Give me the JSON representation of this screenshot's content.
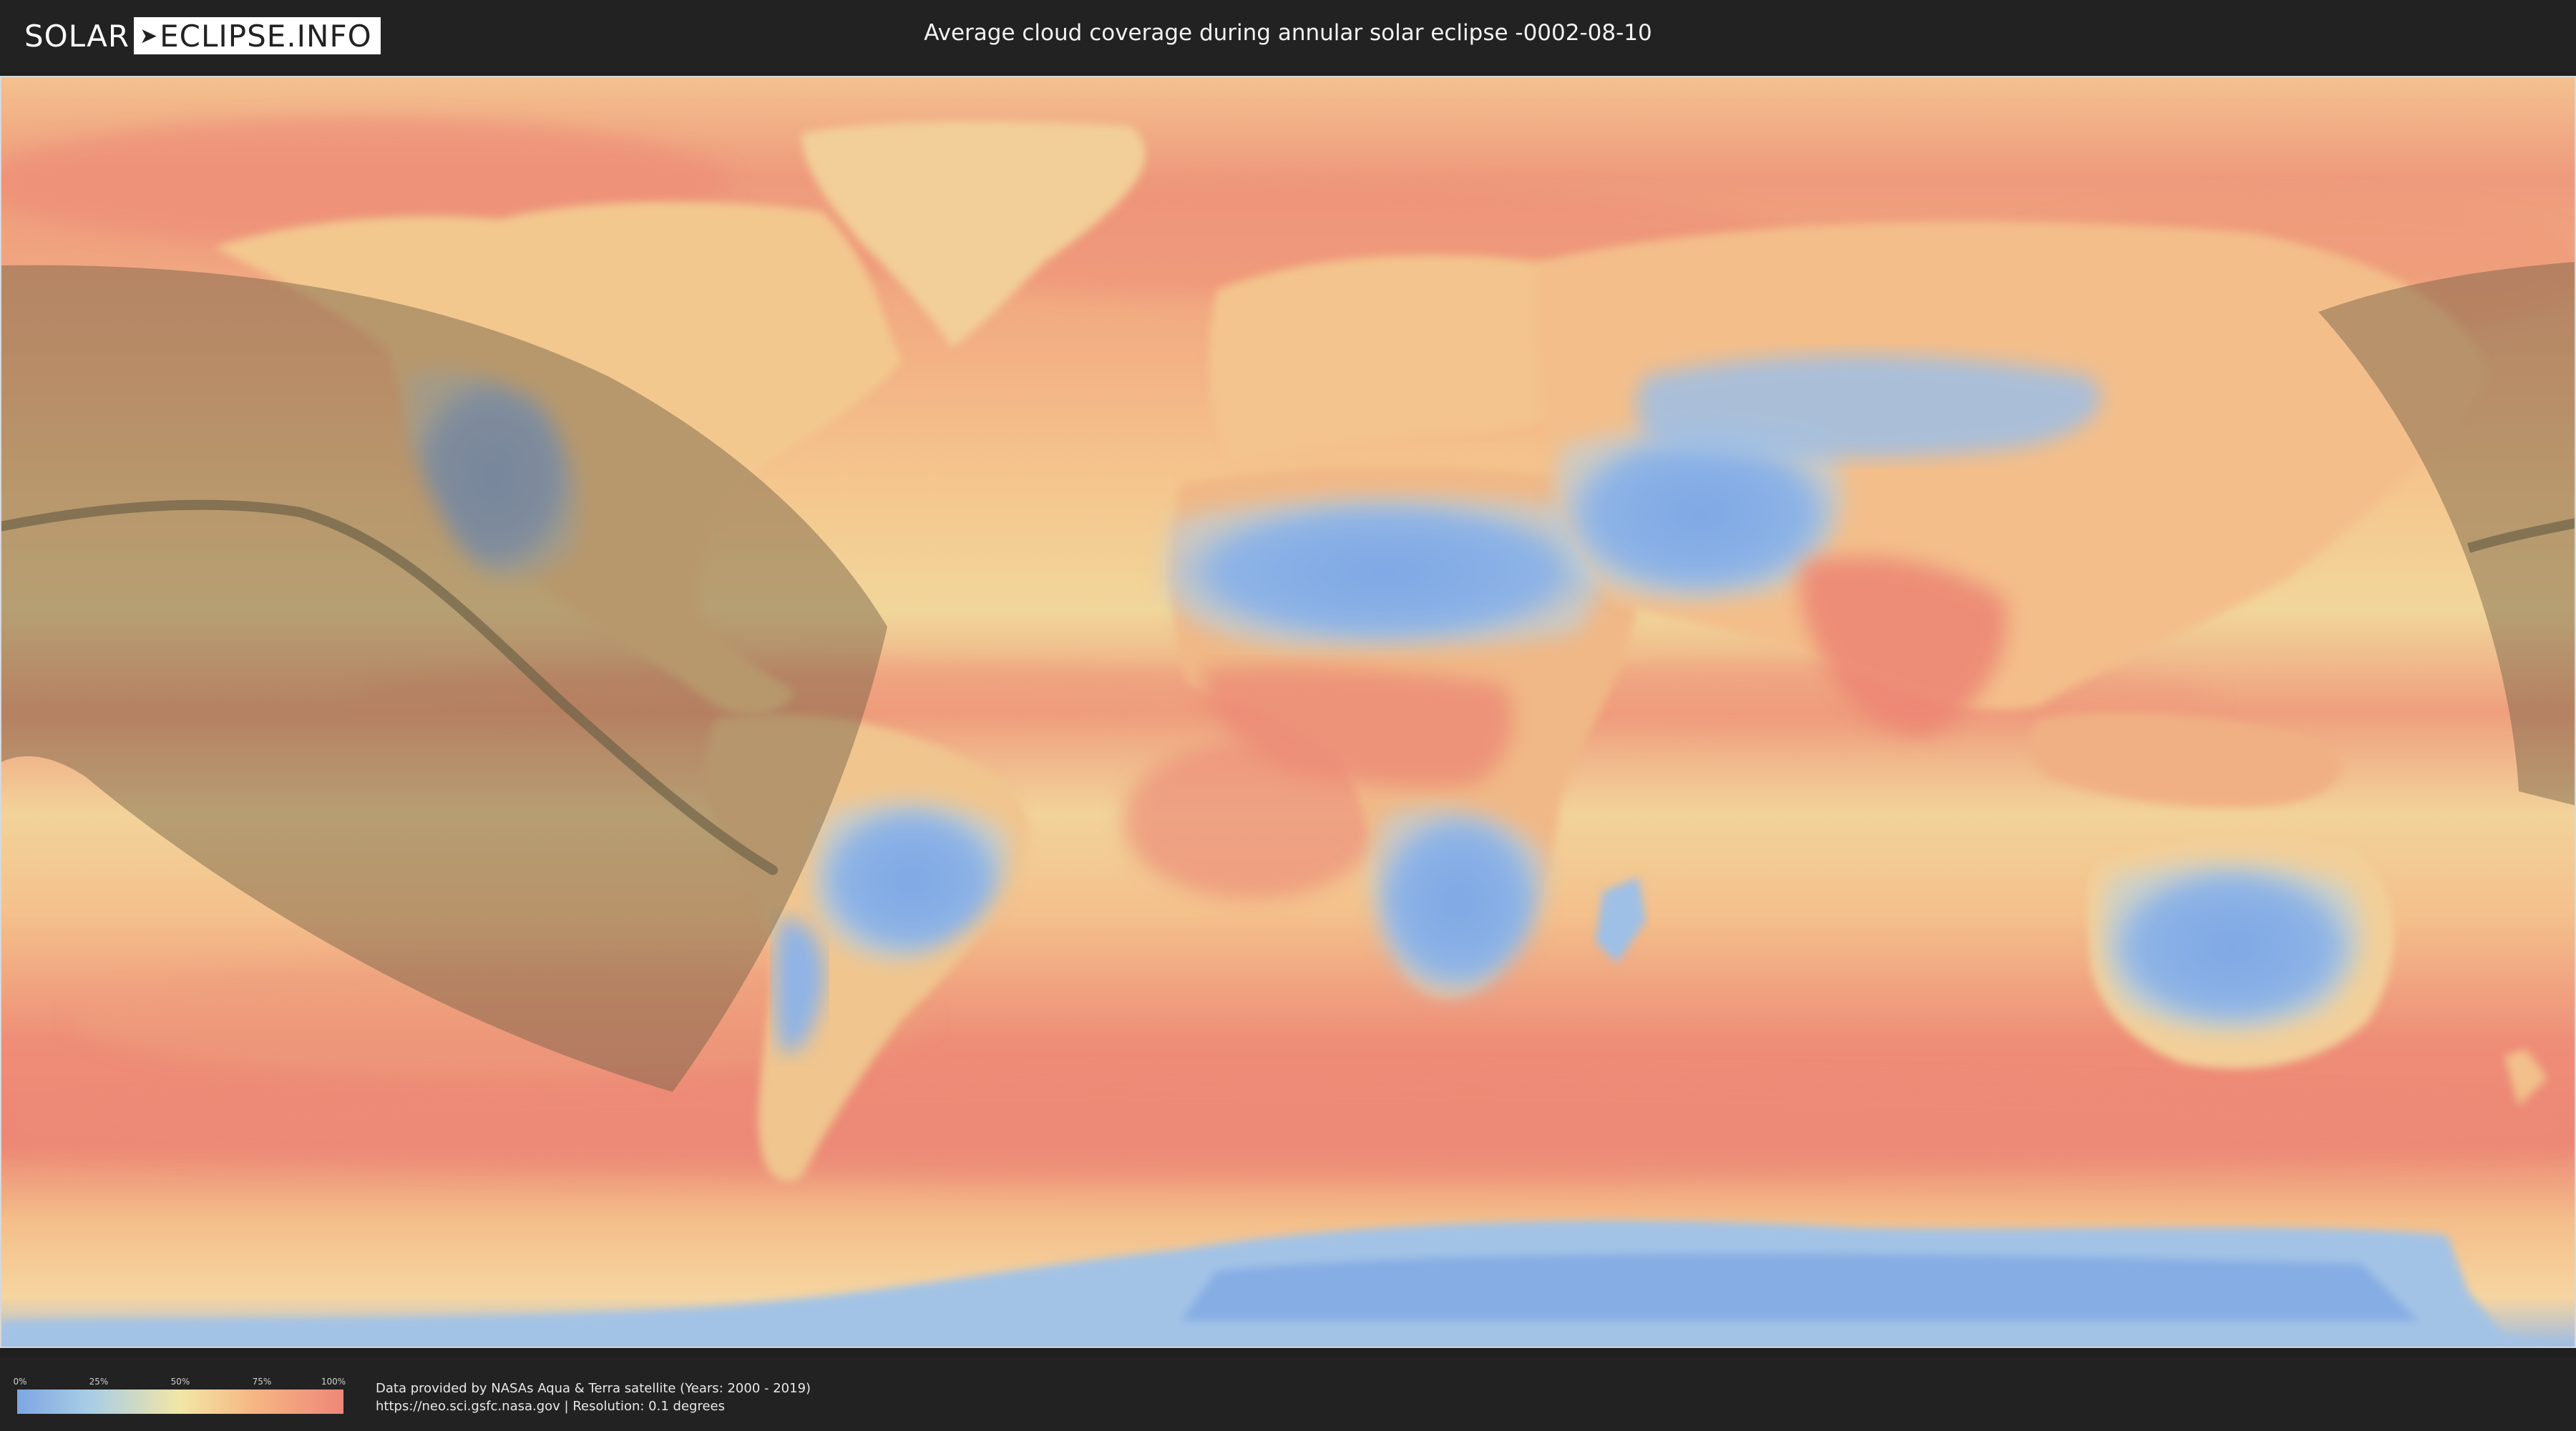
{
  "logo": {
    "left": "SOLAR",
    "right": "ECLIPSE.INFO"
  },
  "title": "Average cloud coverage during annular solar eclipse -0002-08-10",
  "legend": {
    "ticks": [
      "0%",
      "25%",
      "50%",
      "75%",
      "100%"
    ],
    "colors": {
      "low": "#7ea6e3",
      "mid": "#f2e6a6",
      "high": "#ef8678"
    }
  },
  "source": {
    "line1": "Data provided by NASAs Aqua & Terra satellite (Years: 2000 - 2019)",
    "line2": "https://neo.sci.gsfc.nasa.gov | Resolution: 0.1 degrees"
  },
  "map": {
    "projection": "equirectangular",
    "palette": {
      "ocean": "#f1a27f",
      "clear": "#7fa7e4",
      "overlay": "#6e5e42"
    }
  }
}
